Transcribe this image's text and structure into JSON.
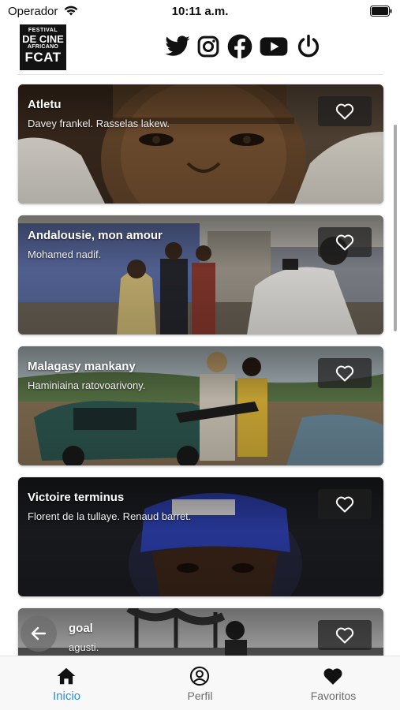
{
  "status_bar": {
    "carrier": "Operador",
    "time": "10:11 a.m."
  },
  "header": {
    "logo": {
      "line1": "FESTIVAL",
      "line2": "DE CINE",
      "line3": "AFRICANO",
      "line4": "FCAT"
    },
    "social_icons": [
      "twitter-icon",
      "instagram-icon",
      "facebook-icon",
      "youtube-icon",
      "power-icon"
    ]
  },
  "films": [
    {
      "title": "Atletu",
      "credits": "Davey frankel. Rasselas lakew."
    },
    {
      "title": "Andalousie, mon amour",
      "credits": "Mohamed nadif."
    },
    {
      "title": "Malagasy mankany",
      "credits": "Haminiaina ratovoarivony."
    },
    {
      "title": "Victoire terminus",
      "credits": "Florent de la tullaye. Renaud barret."
    },
    {
      "title": "goal",
      "credits": "agusti."
    }
  ],
  "nav": {
    "items": [
      {
        "label": "Inicio",
        "icon": "home-icon",
        "active": true
      },
      {
        "label": "Perfil",
        "icon": "profile-icon",
        "active": false
      },
      {
        "label": "Favoritos",
        "icon": "heart-icon",
        "active": false
      }
    ],
    "active_color": "#2e8fd8"
  }
}
